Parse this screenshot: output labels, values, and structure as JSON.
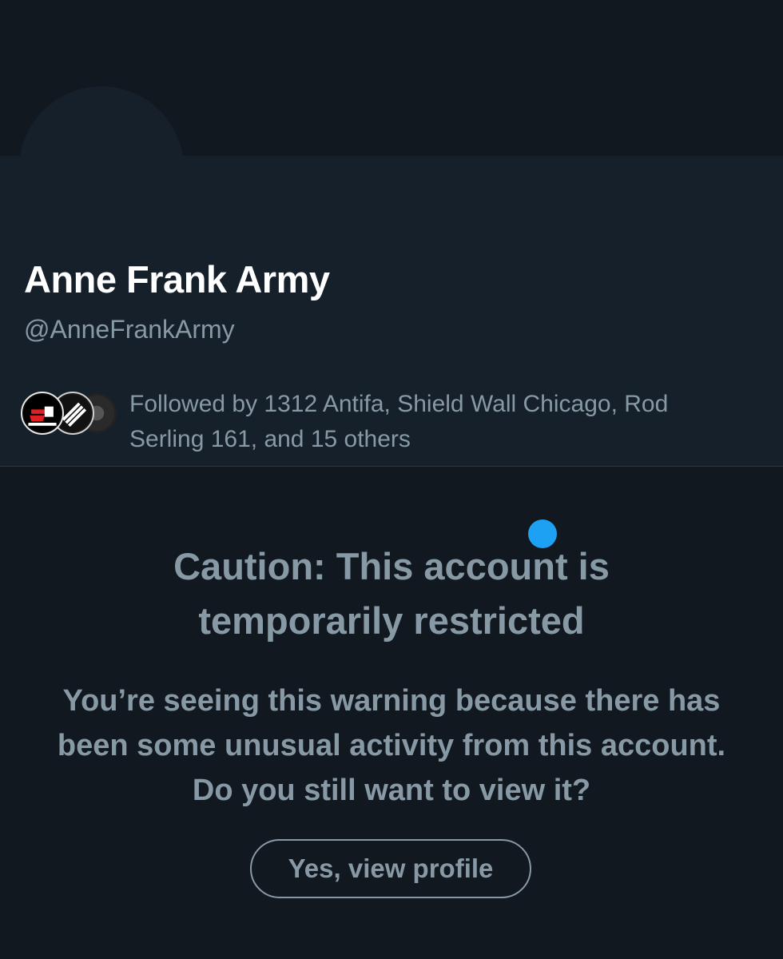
{
  "profile": {
    "display_name": "Anne Frank Army",
    "handle": "@AnneFrankArmy",
    "followed_by_text": "Followed by 1312 Antifa, Shield Wall Chicago, Rod Serling 161, and 15 others"
  },
  "warning": {
    "title": "Caution: This account is temporarily restricted",
    "body": "You’re seeing this warning because there has been some unusual activity from this account. Do you still want to view it?",
    "button_label": "Yes, view profile"
  },
  "colors": {
    "background": "#111820",
    "card": "#15202b",
    "muted_text": "#8899a6",
    "accent": "#1da1f2"
  }
}
